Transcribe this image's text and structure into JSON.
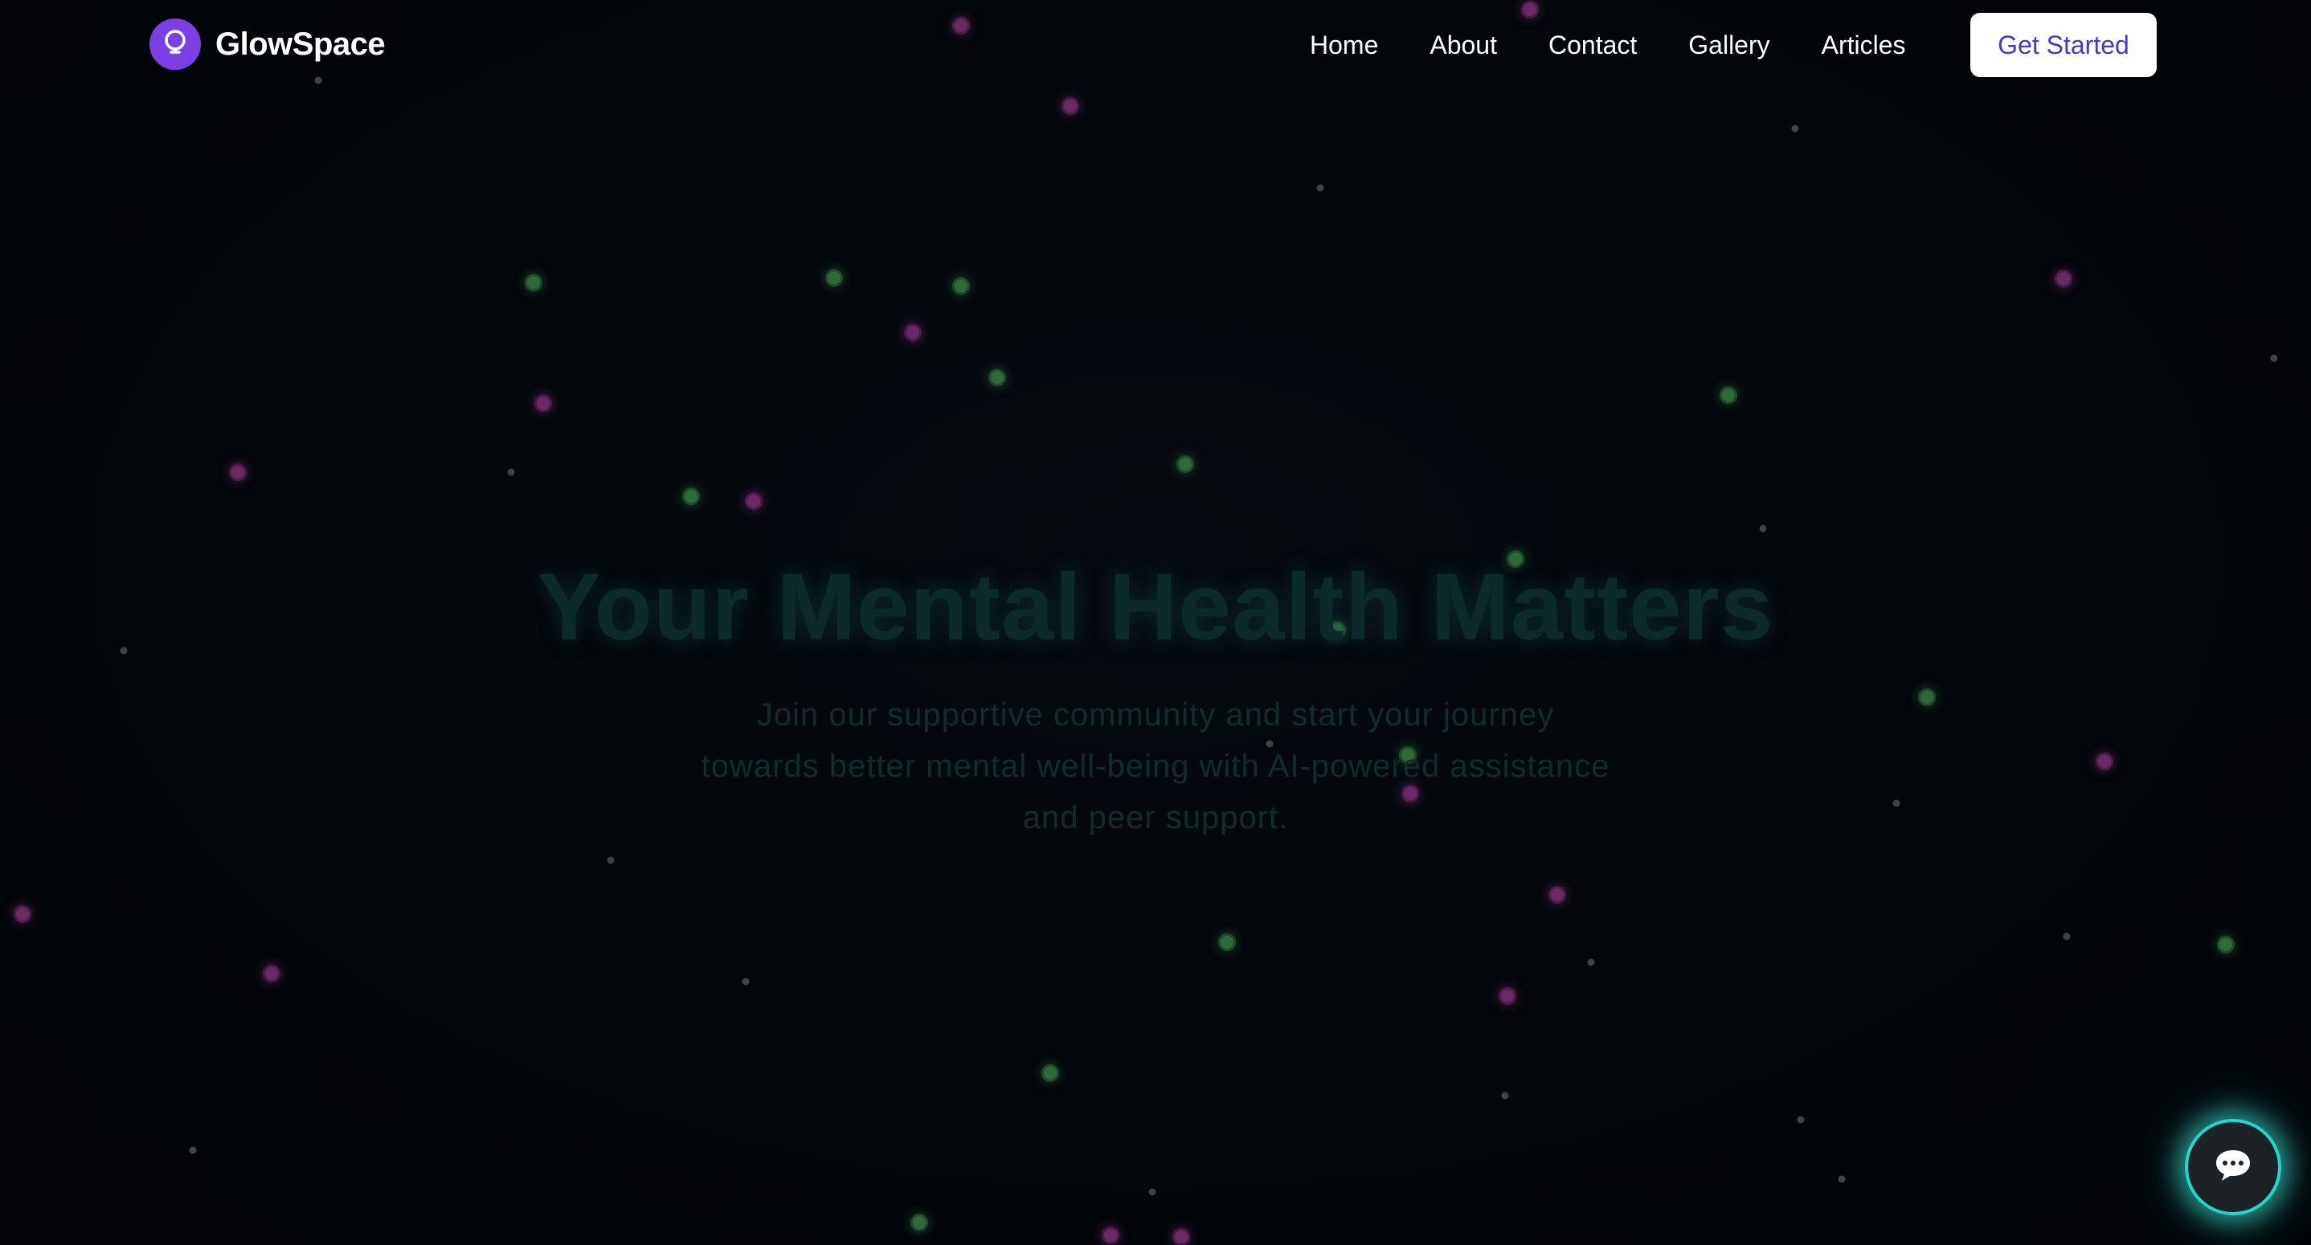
{
  "brand": {
    "name": "GlowSpace",
    "logo_icon": "lightbulb-icon",
    "accent": "#7b3fe4"
  },
  "nav": {
    "items": [
      "Home",
      "About",
      "Contact",
      "Gallery",
      "Articles"
    ],
    "cta_label": "Get Started",
    "cta_color": "#4338ca"
  },
  "hero": {
    "title": "Your Mental Health Matters",
    "subtitle": "Join our supportive community and start your journey towards better mental well-being with AI-powered assistance and peer support."
  },
  "chat": {
    "icon": "chat-bubble-icon",
    "glow_color": "#24d6c8"
  }
}
